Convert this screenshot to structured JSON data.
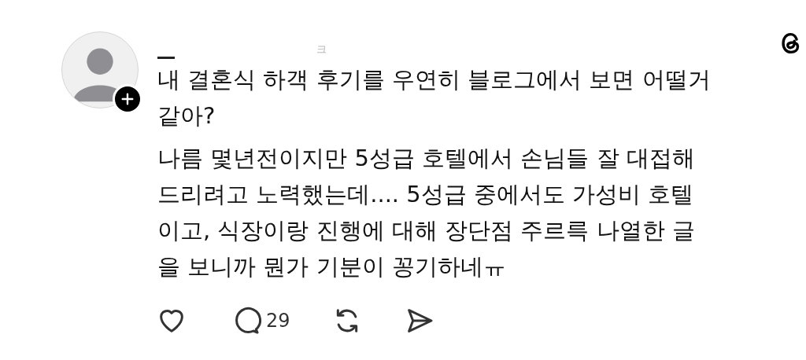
{
  "post": {
    "username_fragment": "크",
    "paragraphs": [
      "내 결혼식 하객 후기를 우연히 블로그에서 보면 어떨거 같아?",
      "나름 몇년전이지만 5성급 호텔에서 손님들 잘 대접해 드리려고 노력했는데.... 5성급 중에서도 가성비 호텔 이고, 식장이랑 진행에 대해 장단점 주르륵 나열한 글을 보니까 뭔가 기분이 꽁기하네ㅠ"
    ],
    "actions": {
      "reply_count": "29"
    }
  }
}
